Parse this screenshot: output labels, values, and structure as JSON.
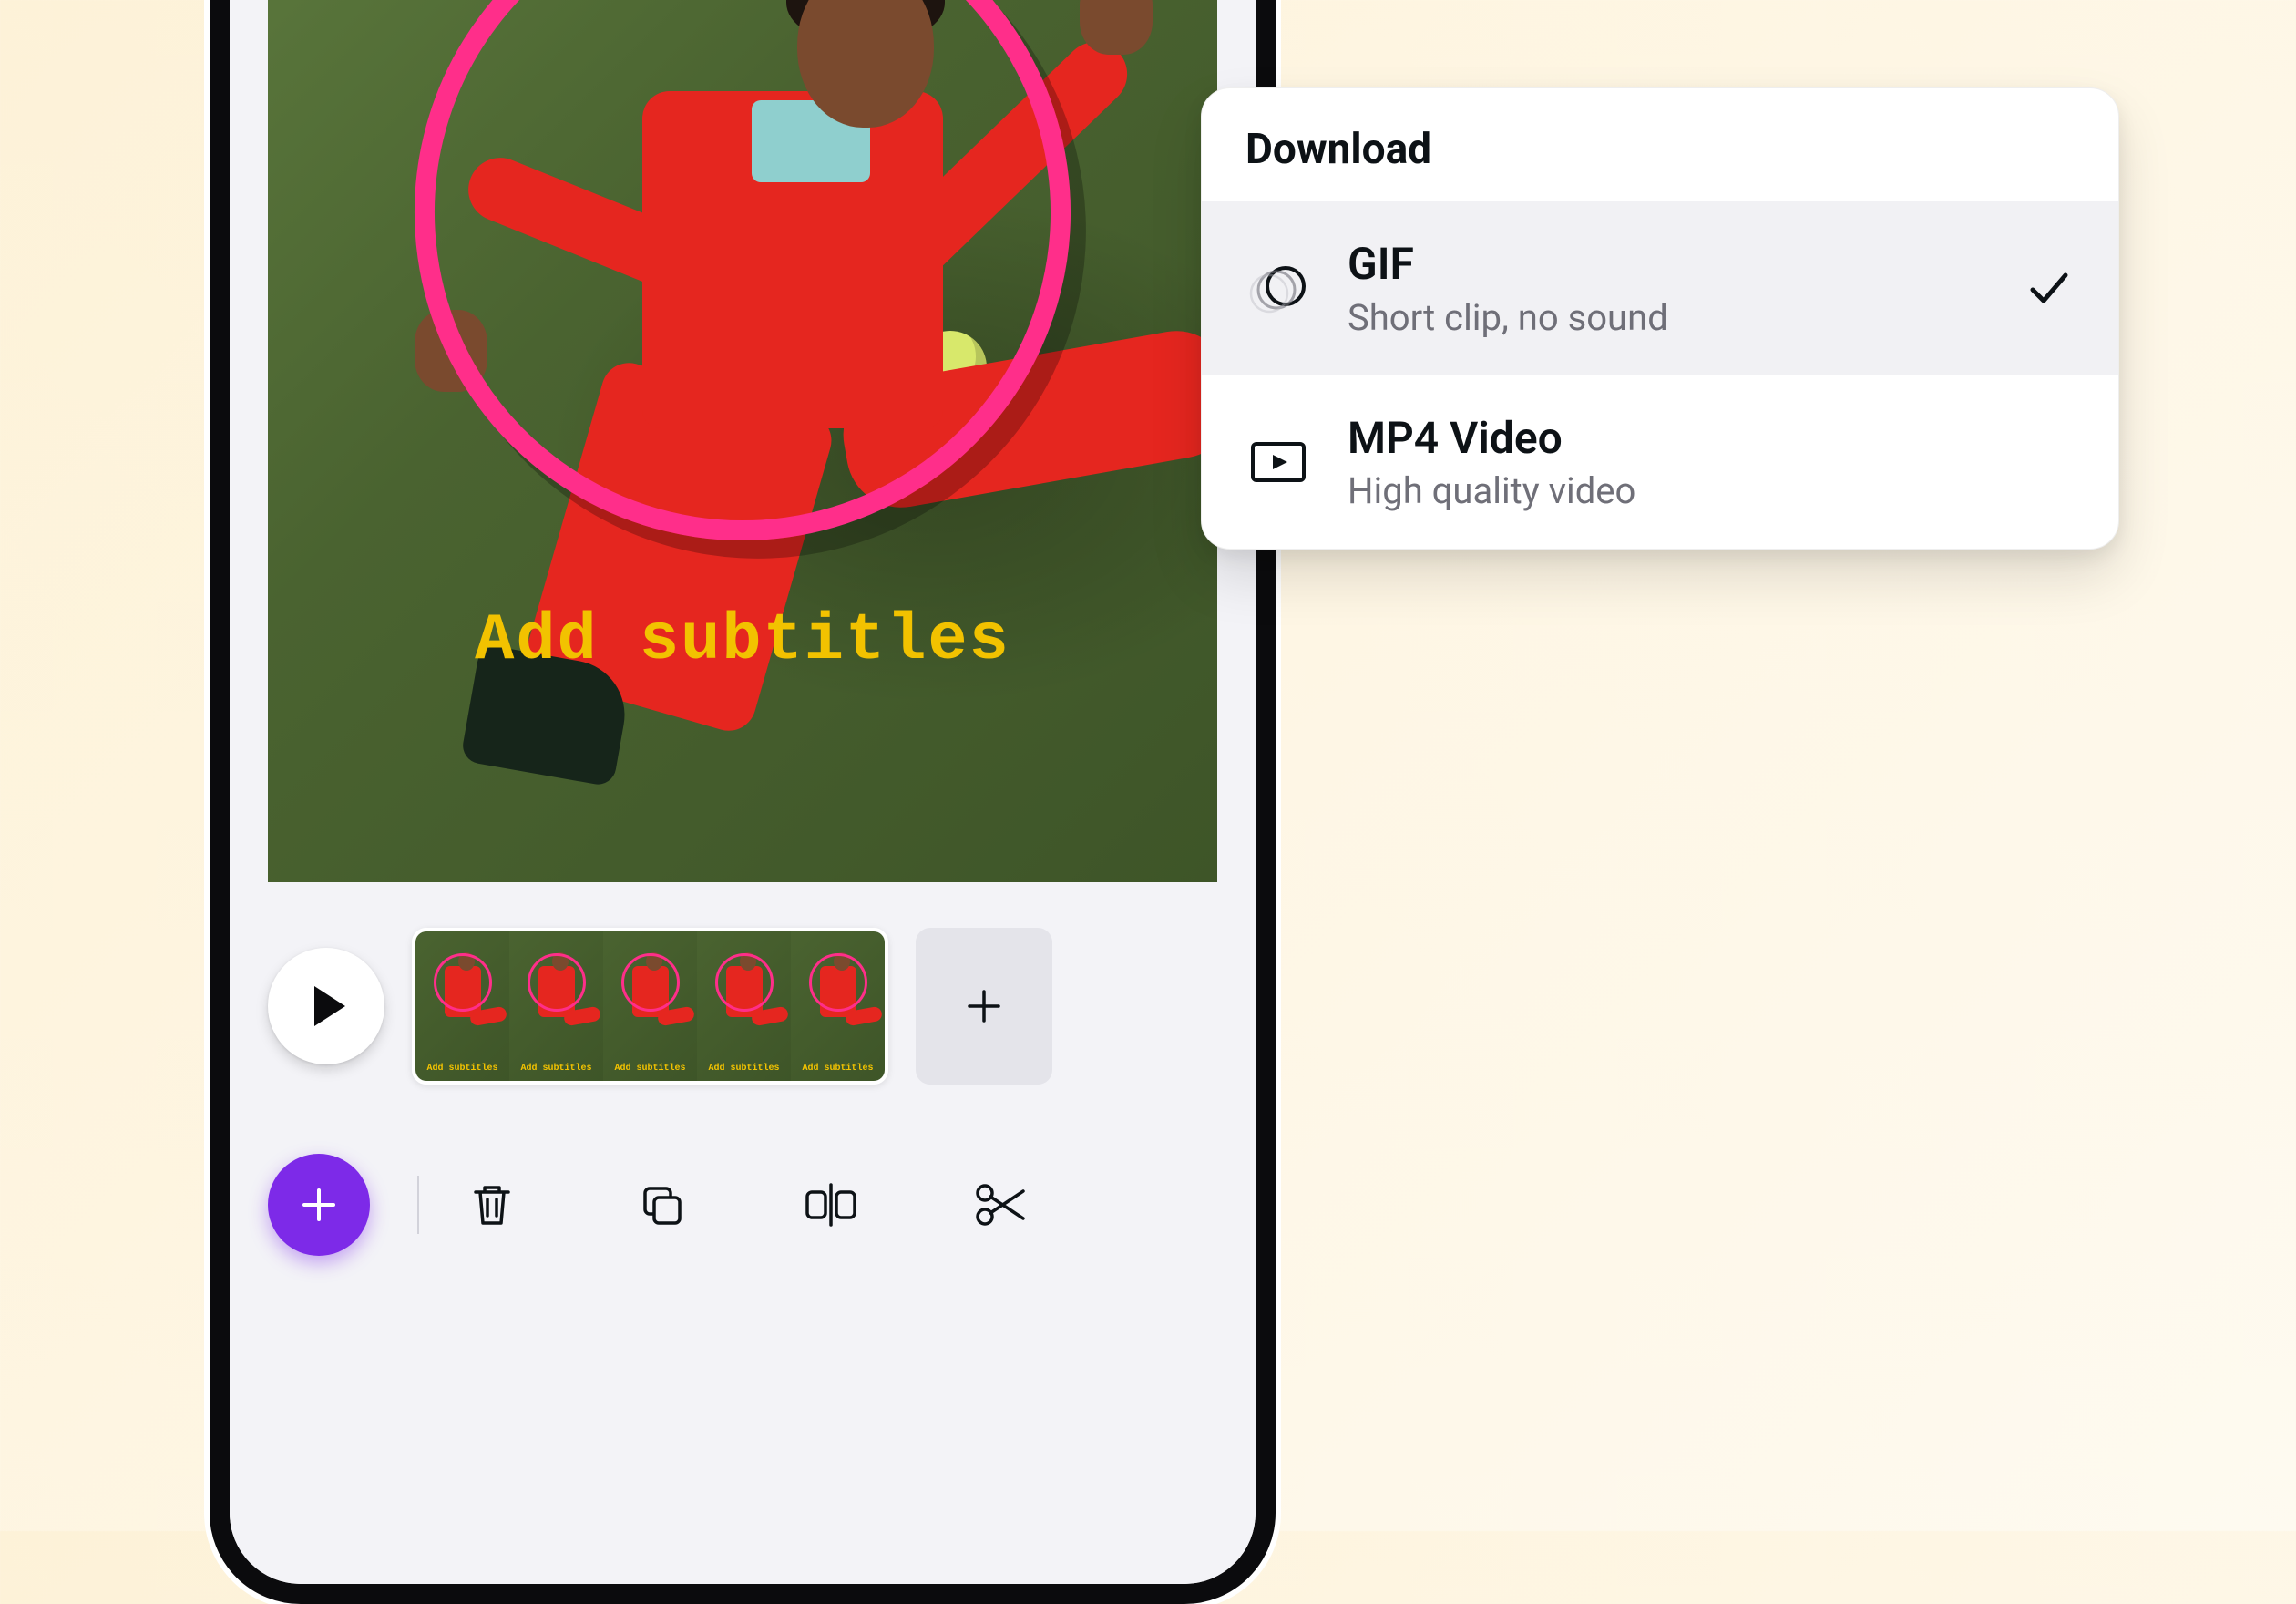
{
  "canvas": {
    "subtitle_overlay": "Add subtitles"
  },
  "timeline": {
    "thumbnail_label": "Add subtitles",
    "thumbnail_count": 5
  },
  "download_panel": {
    "title": "Download",
    "options": [
      {
        "id": "gif",
        "title": "GIF",
        "subtitle": "Short clip, no sound",
        "selected": true,
        "icon": "gif-motion-icon"
      },
      {
        "id": "mp4",
        "title": "MP4 Video",
        "subtitle": "High quality video",
        "selected": false,
        "icon": "video-play-icon"
      }
    ]
  },
  "toolbar": {
    "fab_icon": "plus",
    "tools": [
      "trash",
      "duplicate",
      "split",
      "cut"
    ]
  },
  "colors": {
    "accent_purple": "#7d2ae8",
    "subtitle_yellow": "#f2c200",
    "hoop_pink": "#ff2e8a",
    "suit_red": "#e5261f"
  }
}
